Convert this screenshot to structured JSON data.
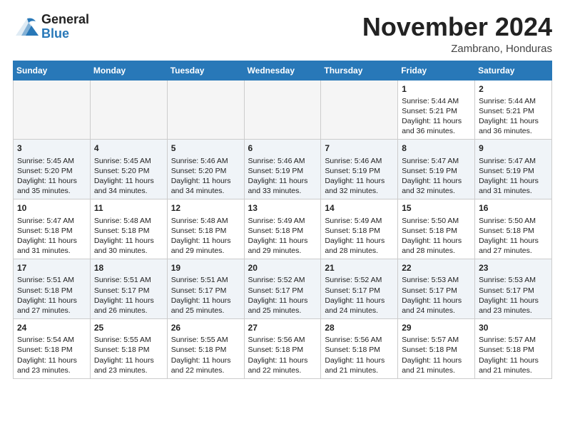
{
  "header": {
    "logo_general": "General",
    "logo_blue": "Blue",
    "month_title": "November 2024",
    "location": "Zambrano, Honduras"
  },
  "weekdays": [
    "Sunday",
    "Monday",
    "Tuesday",
    "Wednesday",
    "Thursday",
    "Friday",
    "Saturday"
  ],
  "weeks": [
    [
      {
        "day": "",
        "empty": true
      },
      {
        "day": "",
        "empty": true
      },
      {
        "day": "",
        "empty": true
      },
      {
        "day": "",
        "empty": true
      },
      {
        "day": "",
        "empty": true
      },
      {
        "day": "1",
        "sunrise": "Sunrise: 5:44 AM",
        "sunset": "Sunset: 5:21 PM",
        "daylight": "Daylight: 11 hours and 36 minutes."
      },
      {
        "day": "2",
        "sunrise": "Sunrise: 5:44 AM",
        "sunset": "Sunset: 5:21 PM",
        "daylight": "Daylight: 11 hours and 36 minutes."
      }
    ],
    [
      {
        "day": "3",
        "sunrise": "Sunrise: 5:45 AM",
        "sunset": "Sunset: 5:20 PM",
        "daylight": "Daylight: 11 hours and 35 minutes."
      },
      {
        "day": "4",
        "sunrise": "Sunrise: 5:45 AM",
        "sunset": "Sunset: 5:20 PM",
        "daylight": "Daylight: 11 hours and 34 minutes."
      },
      {
        "day": "5",
        "sunrise": "Sunrise: 5:46 AM",
        "sunset": "Sunset: 5:20 PM",
        "daylight": "Daylight: 11 hours and 34 minutes."
      },
      {
        "day": "6",
        "sunrise": "Sunrise: 5:46 AM",
        "sunset": "Sunset: 5:19 PM",
        "daylight": "Daylight: 11 hours and 33 minutes."
      },
      {
        "day": "7",
        "sunrise": "Sunrise: 5:46 AM",
        "sunset": "Sunset: 5:19 PM",
        "daylight": "Daylight: 11 hours and 32 minutes."
      },
      {
        "day": "8",
        "sunrise": "Sunrise: 5:47 AM",
        "sunset": "Sunset: 5:19 PM",
        "daylight": "Daylight: 11 hours and 32 minutes."
      },
      {
        "day": "9",
        "sunrise": "Sunrise: 5:47 AM",
        "sunset": "Sunset: 5:19 PM",
        "daylight": "Daylight: 11 hours and 31 minutes."
      }
    ],
    [
      {
        "day": "10",
        "sunrise": "Sunrise: 5:47 AM",
        "sunset": "Sunset: 5:18 PM",
        "daylight": "Daylight: 11 hours and 31 minutes."
      },
      {
        "day": "11",
        "sunrise": "Sunrise: 5:48 AM",
        "sunset": "Sunset: 5:18 PM",
        "daylight": "Daylight: 11 hours and 30 minutes."
      },
      {
        "day": "12",
        "sunrise": "Sunrise: 5:48 AM",
        "sunset": "Sunset: 5:18 PM",
        "daylight": "Daylight: 11 hours and 29 minutes."
      },
      {
        "day": "13",
        "sunrise": "Sunrise: 5:49 AM",
        "sunset": "Sunset: 5:18 PM",
        "daylight": "Daylight: 11 hours and 29 minutes."
      },
      {
        "day": "14",
        "sunrise": "Sunrise: 5:49 AM",
        "sunset": "Sunset: 5:18 PM",
        "daylight": "Daylight: 11 hours and 28 minutes."
      },
      {
        "day": "15",
        "sunrise": "Sunrise: 5:50 AM",
        "sunset": "Sunset: 5:18 PM",
        "daylight": "Daylight: 11 hours and 28 minutes."
      },
      {
        "day": "16",
        "sunrise": "Sunrise: 5:50 AM",
        "sunset": "Sunset: 5:18 PM",
        "daylight": "Daylight: 11 hours and 27 minutes."
      }
    ],
    [
      {
        "day": "17",
        "sunrise": "Sunrise: 5:51 AM",
        "sunset": "Sunset: 5:18 PM",
        "daylight": "Daylight: 11 hours and 27 minutes."
      },
      {
        "day": "18",
        "sunrise": "Sunrise: 5:51 AM",
        "sunset": "Sunset: 5:17 PM",
        "daylight": "Daylight: 11 hours and 26 minutes."
      },
      {
        "day": "19",
        "sunrise": "Sunrise: 5:51 AM",
        "sunset": "Sunset: 5:17 PM",
        "daylight": "Daylight: 11 hours and 25 minutes."
      },
      {
        "day": "20",
        "sunrise": "Sunrise: 5:52 AM",
        "sunset": "Sunset: 5:17 PM",
        "daylight": "Daylight: 11 hours and 25 minutes."
      },
      {
        "day": "21",
        "sunrise": "Sunrise: 5:52 AM",
        "sunset": "Sunset: 5:17 PM",
        "daylight": "Daylight: 11 hours and 24 minutes."
      },
      {
        "day": "22",
        "sunrise": "Sunrise: 5:53 AM",
        "sunset": "Sunset: 5:17 PM",
        "daylight": "Daylight: 11 hours and 24 minutes."
      },
      {
        "day": "23",
        "sunrise": "Sunrise: 5:53 AM",
        "sunset": "Sunset: 5:17 PM",
        "daylight": "Daylight: 11 hours and 23 minutes."
      }
    ],
    [
      {
        "day": "24",
        "sunrise": "Sunrise: 5:54 AM",
        "sunset": "Sunset: 5:18 PM",
        "daylight": "Daylight: 11 hours and 23 minutes."
      },
      {
        "day": "25",
        "sunrise": "Sunrise: 5:55 AM",
        "sunset": "Sunset: 5:18 PM",
        "daylight": "Daylight: 11 hours and 23 minutes."
      },
      {
        "day": "26",
        "sunrise": "Sunrise: 5:55 AM",
        "sunset": "Sunset: 5:18 PM",
        "daylight": "Daylight: 11 hours and 22 minutes."
      },
      {
        "day": "27",
        "sunrise": "Sunrise: 5:56 AM",
        "sunset": "Sunset: 5:18 PM",
        "daylight": "Daylight: 11 hours and 22 minutes."
      },
      {
        "day": "28",
        "sunrise": "Sunrise: 5:56 AM",
        "sunset": "Sunset: 5:18 PM",
        "daylight": "Daylight: 11 hours and 21 minutes."
      },
      {
        "day": "29",
        "sunrise": "Sunrise: 5:57 AM",
        "sunset": "Sunset: 5:18 PM",
        "daylight": "Daylight: 11 hours and 21 minutes."
      },
      {
        "day": "30",
        "sunrise": "Sunrise: 5:57 AM",
        "sunset": "Sunset: 5:18 PM",
        "daylight": "Daylight: 11 hours and 21 minutes."
      }
    ]
  ]
}
